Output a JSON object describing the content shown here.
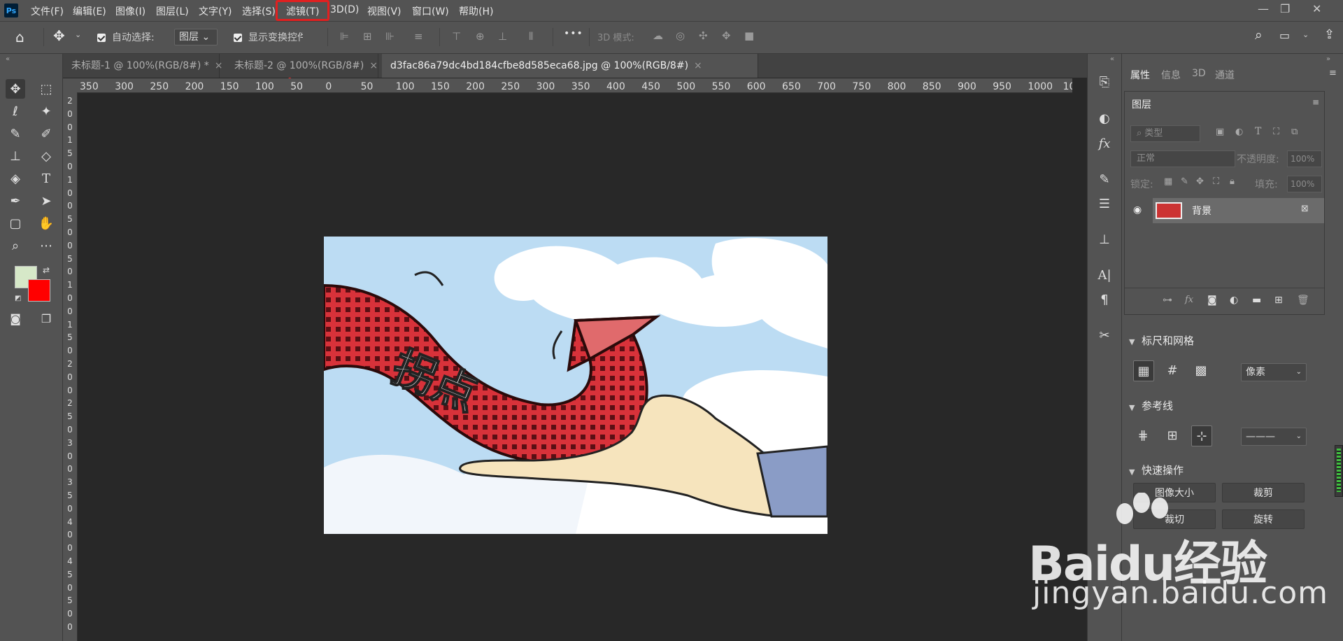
{
  "app": {
    "logo": "Ps"
  },
  "menu": [
    "文件(F)",
    "编辑(E)",
    "图像(I)",
    "图层(L)",
    "文字(Y)",
    "选择(S)",
    "滤镜(T)",
    "3D(D)",
    "视图(V)",
    "窗口(W)",
    "帮助(H)"
  ],
  "highlighted_menu": "滤镜(T)",
  "window_controls": {
    "minimize": "—",
    "restore": "❐",
    "close": "✕"
  },
  "options": {
    "auto_select_label": "自动选择:",
    "auto_select_value": "图层",
    "show_transform_label": "显示变换控件",
    "three_d_mode_label": "3D 模式:",
    "more": "•••"
  },
  "tabs": [
    {
      "label": "未标题-1 @ 100%(RGB/8#) *",
      "close": "×"
    },
    {
      "label": "未标题-2 @ 100%(RGB/8#)",
      "close": "×"
    },
    {
      "label": "d3fac86a79dc4bd184cfbe8d585eca68.jpg @ 100%(RGB/8#)",
      "close": "×"
    }
  ],
  "ruler_h": [
    "350",
    "300",
    "250",
    "200",
    "150",
    "100",
    "50",
    "0",
    "50",
    "100",
    "150",
    "200",
    "250",
    "300",
    "350",
    "400",
    "450",
    "500",
    "550",
    "600",
    "650",
    "700",
    "750",
    "800",
    "850",
    "900",
    "950",
    "1000",
    "10"
  ],
  "ruler_v": [
    "2",
    "0",
    "0",
    "1",
    "5",
    "0",
    "1",
    "0",
    "0",
    "5",
    "0",
    "0",
    "5",
    "0",
    "1",
    "0",
    "0",
    "1",
    "5",
    "0",
    "2",
    "0",
    "0",
    "2",
    "5",
    "0",
    "3",
    "0",
    "0",
    "3",
    "5",
    "0",
    "4",
    "0",
    "0",
    "4",
    "5",
    "0",
    "5",
    "0",
    "0"
  ],
  "colors": {
    "foreground": "#d6e8c8",
    "background": "#ff0000",
    "accent": "#e02020"
  },
  "image_text": "拐点",
  "panel_tabs": [
    "属性",
    "信息",
    "3D",
    "通道"
  ],
  "layers": {
    "title": "图层",
    "filter_placeholder": "类型",
    "blend_mode": "正常",
    "opacity_label": "不透明度:",
    "opacity_value": "100%",
    "lock_label": "锁定:",
    "fill_label": "填充:",
    "fill_value": "100%",
    "items": [
      {
        "name": "背景"
      }
    ]
  },
  "rulers_grids": {
    "title": "标尺和网格",
    "unit": "像素"
  },
  "guides": {
    "title": "参考线",
    "line_style": "———"
  },
  "quick_actions": {
    "title": "快速操作",
    "buttons": [
      "图像大小",
      "裁剪",
      "裁切",
      "旋转"
    ]
  },
  "watermark": {
    "brand": "Baidu经验",
    "url": "jingyan.baidu.com"
  }
}
